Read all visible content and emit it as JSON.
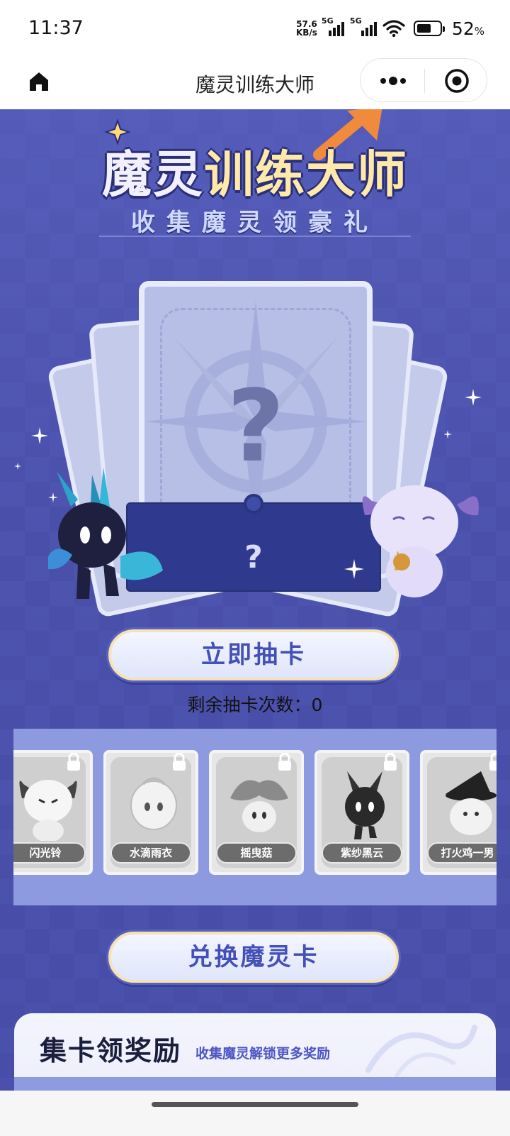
{
  "status_bar": {
    "time": "11:37",
    "net_speed_value": "57.6",
    "net_speed_unit": "KB/s",
    "signal_1_label": "5G",
    "signal_2_label": "5G",
    "battery_percent": 52,
    "battery_value": "52",
    "battery_unit": "%"
  },
  "nav": {
    "title": "魔灵训练大师"
  },
  "logo": {
    "title_part1": "魔灵",
    "title_part2": "训练大师",
    "subtitle": "收集魔灵领豪礼"
  },
  "card_stage": {
    "mystery_mark": "?",
    "envelope_mark": "?"
  },
  "draw_button": {
    "label": "立即抽卡"
  },
  "remaining": {
    "text": "剩余抽卡次数：0"
  },
  "card_strip": {
    "cards": [
      {
        "name": "闪光铃",
        "locked": true
      },
      {
        "name": "水滴雨衣",
        "locked": true
      },
      {
        "name": "摇曳菇",
        "locked": true
      },
      {
        "name": "紫纱黑云",
        "locked": true
      },
      {
        "name": "打火鸡一男",
        "locked": true
      }
    ]
  },
  "exchange_button": {
    "label": "兑换魔灵卡"
  },
  "reward": {
    "title": "集卡领奖励",
    "subtitle": "收集魔灵解锁更多奖励"
  },
  "colors": {
    "background": "#4a4fa8",
    "button_text": "#4350b8",
    "strip_bg": "#8d9ae0",
    "reward_sub": "#4d56c4"
  }
}
